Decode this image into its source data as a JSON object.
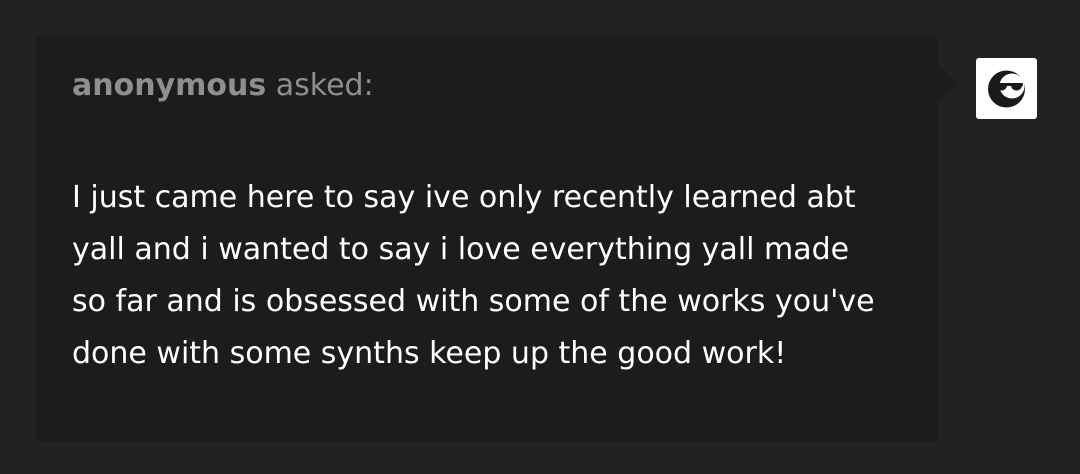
{
  "ask": {
    "asker_name": "anonymous",
    "asked_suffix": "asked:",
    "question_lines": [
      "I just came here to say ive only recently learned abt",
      "yall and i wanted to say i love everything yall made",
      "so far and is obsessed with some of the works you've",
      "done with some synths keep up the good work!"
    ]
  },
  "avatar": {
    "icon": "anonymous-sunglasses-icon",
    "background_color": "#ffffff",
    "icon_color": "#1a1a1a"
  },
  "colors": {
    "page_background": "#222222",
    "bubble_background": "#1c1c1c",
    "asker_text": "#8f8f8f",
    "body_text": "#ffffff"
  }
}
